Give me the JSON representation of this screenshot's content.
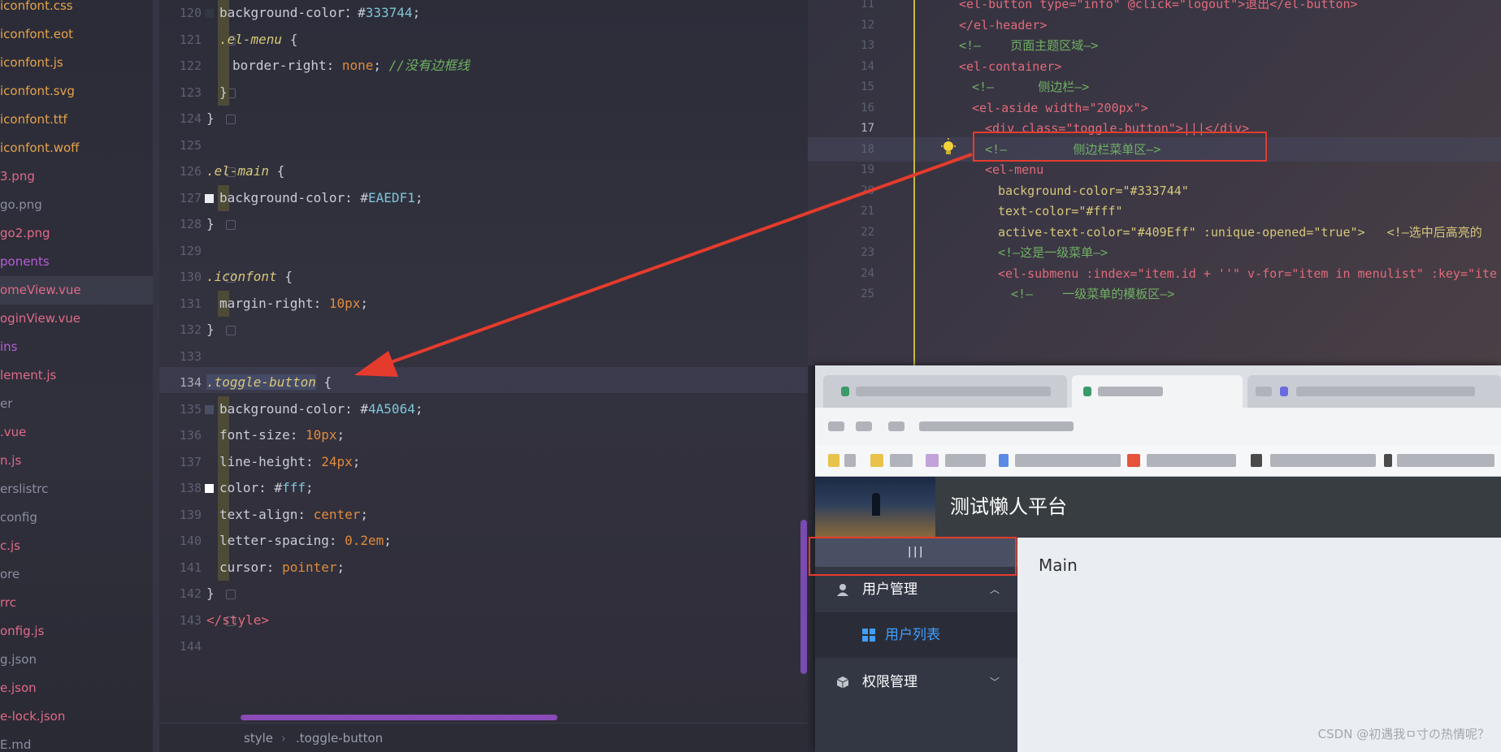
{
  "file_tree": {
    "items": [
      {
        "label": "iconfont.css",
        "color": "#e6a248"
      },
      {
        "label": "iconfont.eot",
        "color": "#e6a248"
      },
      {
        "label": "iconfont.js",
        "color": "#e6a248"
      },
      {
        "label": "iconfont.svg",
        "color": "#e6a248"
      },
      {
        "label": "iconfont.ttf",
        "color": "#e6a248"
      },
      {
        "label": "iconfont.woff",
        "color": "#e6a248"
      },
      {
        "label": "3.png",
        "color": "#e06a86"
      },
      {
        "label": "go.png",
        "color": "#8a8ea0"
      },
      {
        "label": "go2.png",
        "color": "#e06a86"
      },
      {
        "label": "ponents",
        "color": "#b45ed6"
      },
      {
        "label": "omeView.vue",
        "color": "#e06a86"
      },
      {
        "label": "oginView.vue",
        "color": "#e06a86"
      },
      {
        "label": "ins",
        "color": "#b45ed6"
      },
      {
        "label": "lement.js",
        "color": "#e06a86"
      },
      {
        "label": "er",
        "color": "#8a8ea0"
      },
      {
        "label": ".vue",
        "color": "#e06a86"
      },
      {
        "label": "n.js",
        "color": "#e06a86"
      },
      {
        "label": "erslistrc",
        "color": "#8a8ea0"
      },
      {
        "label": "config",
        "color": "#8a8ea0"
      },
      {
        "label": "c.js",
        "color": "#e06a86"
      },
      {
        "label": "ore",
        "color": "#8a8ea0"
      },
      {
        "label": "rrc",
        "color": "#e06a86"
      },
      {
        "label": "onfig.js",
        "color": "#e06a86"
      },
      {
        "label": "g.json",
        "color": "#8a8ea0"
      },
      {
        "label": "e.json",
        "color": "#e06a86"
      },
      {
        "label": "e-lock.json",
        "color": "#e06a86"
      },
      {
        "label": "E.md",
        "color": "#8a8ea0"
      }
    ]
  },
  "editor_left": {
    "lines": [
      {
        "n": "120",
        "indent": 1,
        "parts": [
          [
            "k-prop",
            "background-color"
          ],
          [
            "",
            "：#"
          ],
          [
            "k-hex",
            "333744"
          ],
          [
            "",
            ";"
          ]
        ]
      },
      {
        "n": "121",
        "indent": 1,
        "parts": [
          [
            "k-sel",
            ".el-menu"
          ],
          [
            "",
            " {"
          ]
        ]
      },
      {
        "n": "122",
        "indent": 2,
        "parts": [
          [
            "k-prop",
            "border-right"
          ],
          [
            "",
            ": "
          ],
          [
            "k-val",
            "none"
          ],
          [
            "",
            "; "
          ],
          [
            "k-comment",
            "//没有边框线"
          ]
        ]
      },
      {
        "n": "123",
        "indent": 1,
        "parts": [
          [
            "",
            "}"
          ]
        ]
      },
      {
        "n": "124",
        "indent": 0,
        "parts": [
          [
            "",
            "}"
          ]
        ]
      },
      {
        "n": "125",
        "indent": 0,
        "parts": []
      },
      {
        "n": "126",
        "indent": 0,
        "parts": [
          [
            "k-sel",
            ".el-main"
          ],
          [
            "",
            " {"
          ]
        ]
      },
      {
        "n": "127",
        "indent": 1,
        "parts": [
          [
            "k-prop",
            "background-color"
          ],
          [
            "",
            ": #"
          ],
          [
            "k-hex",
            "EAEDF1"
          ],
          [
            "",
            ";"
          ]
        ]
      },
      {
        "n": "128",
        "indent": 0,
        "parts": [
          [
            "",
            "}"
          ]
        ]
      },
      {
        "n": "129",
        "indent": 0,
        "parts": []
      },
      {
        "n": "130",
        "indent": 0,
        "parts": [
          [
            "k-sel",
            ".iconfont"
          ],
          [
            "",
            " {"
          ]
        ]
      },
      {
        "n": "131",
        "indent": 1,
        "parts": [
          [
            "k-prop",
            "margin-right"
          ],
          [
            "",
            ": "
          ],
          [
            "k-val",
            "10px"
          ],
          [
            "",
            ";"
          ]
        ]
      },
      {
        "n": "132",
        "indent": 0,
        "parts": [
          [
            "",
            "}"
          ]
        ]
      },
      {
        "n": "133",
        "indent": 0,
        "parts": []
      },
      {
        "n": "134",
        "indent": 0,
        "parts": [
          [
            "k-sel sel-word",
            ".toggle-button"
          ],
          [
            "",
            " {"
          ]
        ]
      },
      {
        "n": "135",
        "indent": 1,
        "parts": [
          [
            "k-prop",
            "background-color"
          ],
          [
            "",
            ": #"
          ],
          [
            "k-hex",
            "4A5064"
          ],
          [
            "",
            ";"
          ]
        ]
      },
      {
        "n": "136",
        "indent": 1,
        "parts": [
          [
            "k-prop",
            "font-size"
          ],
          [
            "",
            ": "
          ],
          [
            "k-val",
            "10px"
          ],
          [
            "",
            ";"
          ]
        ]
      },
      {
        "n": "137",
        "indent": 1,
        "parts": [
          [
            "k-prop",
            "line-height"
          ],
          [
            "",
            ": "
          ],
          [
            "k-val",
            "24px"
          ],
          [
            "",
            ";"
          ]
        ]
      },
      {
        "n": "138",
        "indent": 1,
        "parts": [
          [
            "k-prop",
            "color"
          ],
          [
            "",
            ": #"
          ],
          [
            "k-hex",
            "fff"
          ],
          [
            "",
            ";"
          ]
        ]
      },
      {
        "n": "139",
        "indent": 1,
        "parts": [
          [
            "k-prop",
            "text-align"
          ],
          [
            "",
            ": "
          ],
          [
            "k-val",
            "center"
          ],
          [
            "",
            ";"
          ]
        ]
      },
      {
        "n": "140",
        "indent": 1,
        "parts": [
          [
            "k-prop",
            "letter-spacing"
          ],
          [
            "",
            ": "
          ],
          [
            "k-val",
            "0.2em"
          ],
          [
            "",
            ";"
          ]
        ]
      },
      {
        "n": "141",
        "indent": 1,
        "parts": [
          [
            "k-prop",
            "cursor"
          ],
          [
            "",
            ": "
          ],
          [
            "k-val",
            "pointer"
          ],
          [
            "",
            ";"
          ]
        ]
      },
      {
        "n": "142",
        "indent": 0,
        "parts": [
          [
            "",
            "}"
          ]
        ]
      },
      {
        "n": "143",
        "indent": 0,
        "parts": [
          [
            "k-tag",
            "</style>"
          ]
        ]
      },
      {
        "n": "144",
        "indent": 0,
        "parts": []
      }
    ],
    "current_line": "134",
    "color_swatches": {
      "127": "#EAEDF1",
      "135": "#4A5064",
      "138": "#ffffff",
      "120": "#333744"
    }
  },
  "status_bar": {
    "crumb1": "style",
    "separator": "›",
    "crumb2": ".toggle-button"
  },
  "editor_right": {
    "lines": [
      {
        "n": "11",
        "text": "<el-button type=\"info\" @click=\"logout\">退出</el-button>"
      },
      {
        "n": "12",
        "text": "</el-header>"
      },
      {
        "n": "13",
        "text": "<!—    页面主题区域—>"
      },
      {
        "n": "14",
        "text": "<el-container>"
      },
      {
        "n": "15",
        "text": "  <!—      侧边栏—>"
      },
      {
        "n": "16",
        "text": "  <el-aside width=\"200px\">"
      },
      {
        "n": "17",
        "text": "    <div class=\"toggle-button\">|||</div>"
      },
      {
        "n": "18",
        "text": "    <!—         侧边栏菜单区—>"
      },
      {
        "n": "19",
        "text": "    <el-menu"
      },
      {
        "n": "20",
        "text": "      background-color=\"#333744\""
      },
      {
        "n": "21",
        "text": "      text-color=\"#fff\""
      },
      {
        "n": "22",
        "text": "      active-text-color=\"#409Eff\" :unique-opened=\"true\">   <!—选中后高亮的"
      },
      {
        "n": "23",
        "text": "      <!—这是一级菜单—>"
      },
      {
        "n": "24",
        "text": "      <el-submenu :index=\"item.id + ''\" v-for=\"item in menulist\" :key=\"ite"
      },
      {
        "n": "25",
        "text": "        <!—    一级菜单的模板区—>"
      }
    ],
    "current_line": "17"
  },
  "app": {
    "title": "测试懒人平台",
    "toggle_label": "|||",
    "menu": [
      {
        "label": "用户管理",
        "arrow": "︿",
        "icon": "user-icon"
      },
      {
        "label": "权限管理",
        "arrow": "﹀",
        "icon": "box-icon"
      }
    ],
    "submenu_item": {
      "label": "用户列表",
      "icon": "grid-icon"
    },
    "main_text": "Main",
    "colors": {
      "aside": "#333744",
      "toggle": "#4A5064",
      "main": "#EAEDF1",
      "active": "#409eff",
      "header": "#373d41"
    }
  },
  "watermark": "CSDN @初遇我ㅁ寸の热情呢？"
}
